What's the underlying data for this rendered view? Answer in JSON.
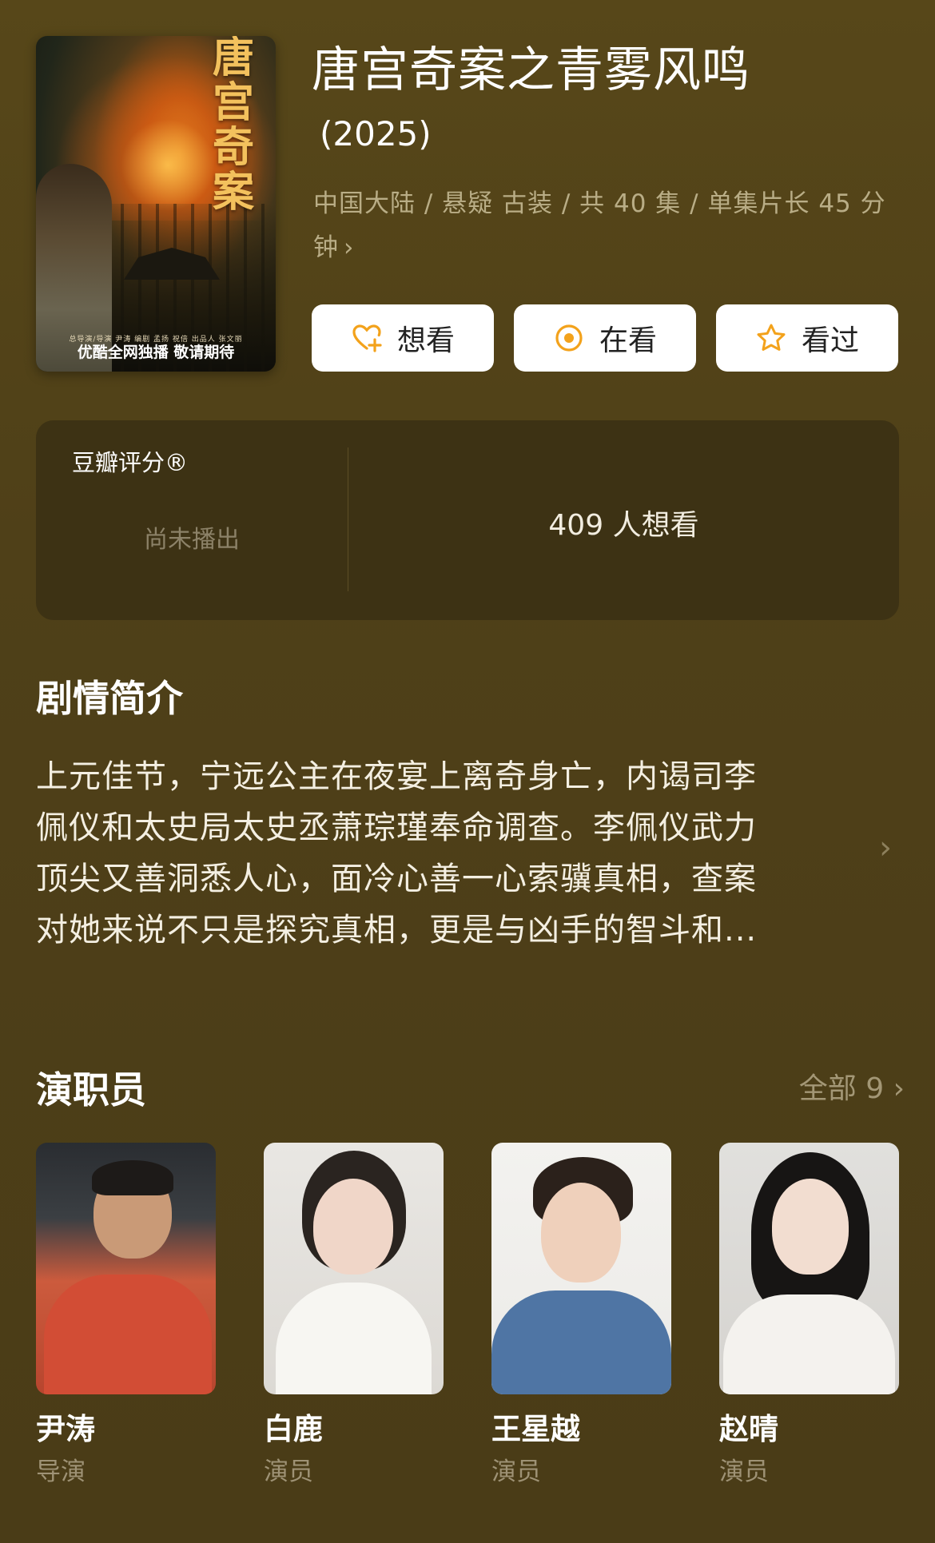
{
  "header": {
    "poster": {
      "calligraphy": [
        "唐",
        "宫",
        "奇",
        "案"
      ],
      "credits": "总导演/导演 尹涛 编剧 孟扬 祝倍 出品人 张文丽",
      "tagline": "优酷全网独播 敬请期待"
    },
    "title": "唐宫奇案之青雾风鸣",
    "year": "(2025)",
    "meta_line1": "中国大陆 / 悬疑 古装 / 共 40 集 / 单集片长 45 分",
    "meta_line2": "钟",
    "meta_chevron": "›",
    "buttons": [
      {
        "label": "想看",
        "icon": "heart-plus-icon"
      },
      {
        "label": "在看",
        "icon": "target-circle-icon"
      },
      {
        "label": "看过",
        "icon": "star-outline-icon"
      }
    ],
    "accent_color": "#f3a21b"
  },
  "rating": {
    "label": "豆瓣评分®",
    "status": "尚未播出",
    "want_count_text": "409 人想看"
  },
  "synopsis": {
    "title": "剧情简介",
    "lines": [
      "上元佳节，宁远公主在夜宴上离奇身亡，内谒司李",
      "佩仪和太史局太史丞萧琮瑾奉命调查。李佩仪武力",
      "顶尖又善洞悉人心，面冷心善一心索骥真相，查案",
      "对她来说不只是探究真相，更是与凶手的智斗和..."
    ],
    "chevron": "›"
  },
  "cast": {
    "title": "演职员",
    "all_label": "全部 9",
    "all_chevron": "›",
    "members": [
      {
        "name": "尹涛",
        "role": "导演"
      },
      {
        "name": "白鹿",
        "role": "演员"
      },
      {
        "name": "王星越",
        "role": "演员"
      },
      {
        "name": "赵晴",
        "role": "演员"
      }
    ]
  },
  "colors": {
    "background": "#4f4018",
    "card": "#3d3214",
    "muted_text": "#b9ad86"
  }
}
